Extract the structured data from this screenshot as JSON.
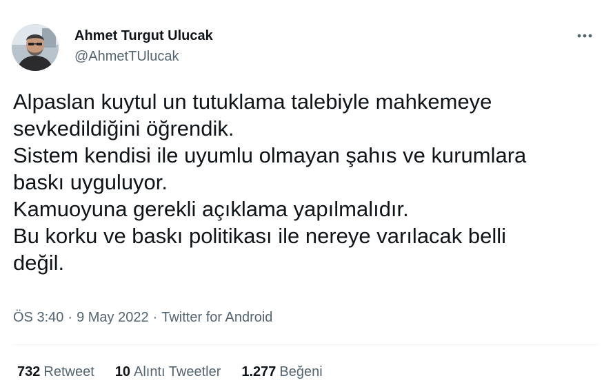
{
  "author": {
    "display_name": "Ahmet Turgut Ulucak",
    "handle": "@AhmetTUlucak",
    "avatar_icon": "profile-photo"
  },
  "more_icon": "more-horizontal-icon",
  "tweet_text_lines": [
    "Alpaslan kuytul un tutuklama talebiyle mahkemeye",
    "sevkedildiğini öğrendik.",
    "Sistem kendisi ile uyumlu olmayan şahıs ve kurumlara",
    "baskı uyguluyor.",
    "Kamuoyuna gerekli açıklama yapılmalıdır.",
    "Bu korku ve baskı politikası ile nereye varılacak belli",
    "değil."
  ],
  "meta": {
    "time": "ÖS 3:40",
    "date": "9 May 2022",
    "source": "Twitter for Android",
    "separator": "·"
  },
  "stats": {
    "retweets_count": "732",
    "retweets_label": "Retweet",
    "quotes_count": "10",
    "quotes_label": "Alıntı Tweetler",
    "likes_count": "1.277",
    "likes_label": "Beğeni"
  },
  "colors": {
    "text_primary": "#0f1419",
    "text_secondary": "#536471",
    "divider": "#eff3f4",
    "background": "#ffffff"
  }
}
